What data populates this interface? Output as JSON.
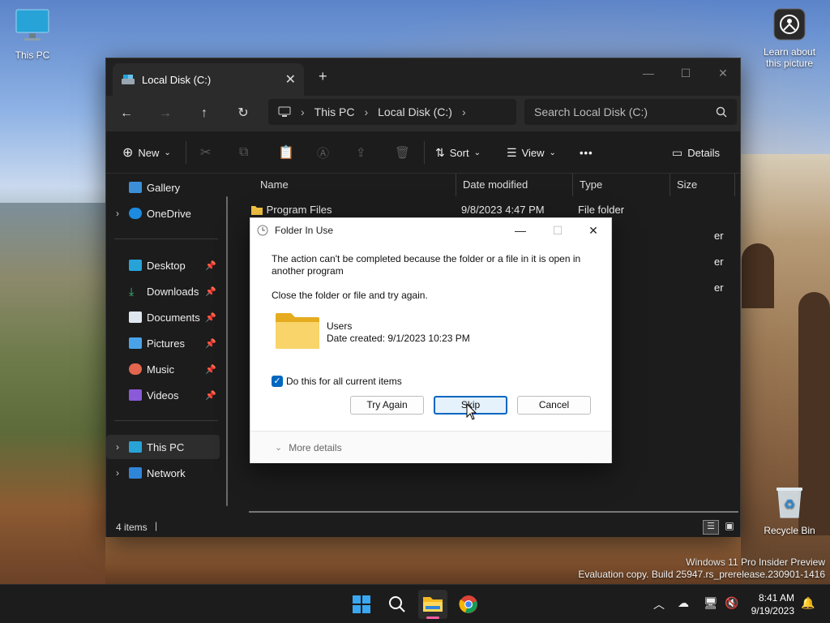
{
  "desktop": {
    "this_pc_label": "This PC",
    "learn_label_line1": "Learn about",
    "learn_label_line2": "this picture",
    "recycle_label": "Recycle Bin",
    "watermark_line1": "Windows 11 Pro Insider Preview",
    "watermark_line2": "Evaluation copy. Build 25947.rs_prerelease.230901-1416"
  },
  "explorer": {
    "tab_title": "Local Disk (C:)",
    "new_tab": "+",
    "breadcrumb": [
      "This PC",
      "Local Disk (C:)"
    ],
    "search_placeholder": "Search Local Disk (C:)",
    "toolbar": {
      "new_label": "New",
      "sort_label": "Sort",
      "view_label": "View",
      "more_label": "•••",
      "details_label": "Details"
    },
    "sidebar": {
      "gallery": "Gallery",
      "onedrive": "OneDrive",
      "desktop": "Desktop",
      "downloads": "Downloads",
      "documents": "Documents",
      "pictures": "Pictures",
      "music": "Music",
      "videos": "Videos",
      "this_pc": "This PC",
      "network": "Network"
    },
    "columns": {
      "name": "Name",
      "date": "Date modified",
      "type": "Type",
      "size": "Size"
    },
    "rows": [
      {
        "name": "Program Files",
        "date": "9/8/2023 4:47 PM",
        "type": "File folder"
      },
      {
        "type": "er"
      },
      {
        "type": "er"
      },
      {
        "type": "er"
      }
    ],
    "status": "4 items"
  },
  "dialog": {
    "title": "Folder In Use",
    "message_line1": "The action can't be completed because the folder or a file in it is open in",
    "message_line2": "another program",
    "instruction": "Close the folder or file and try again.",
    "item_name": "Users",
    "item_date": "Date created: 9/1/2023 10:23 PM",
    "checkbox_label": "Do this for all current items",
    "checkbox_checked": true,
    "buttons": {
      "try_again": "Try Again",
      "skip": "Skip",
      "cancel": "Cancel"
    },
    "more_details": "More details"
  },
  "taskbar": {
    "time": "8:41 AM",
    "date": "9/19/2023"
  },
  "colors": {
    "accent": "#0067c0",
    "folder": "#f4c542",
    "explorer_bg": "#1f1f1f"
  }
}
